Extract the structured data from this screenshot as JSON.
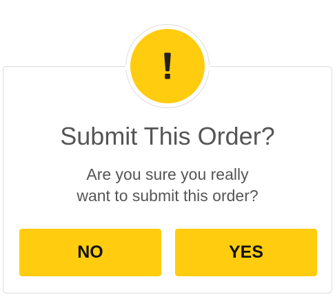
{
  "dialog": {
    "title": "Submit This Order?",
    "message": "Are you sure you really\nwant to submit this order?",
    "no_label": "NO",
    "yes_label": "YES",
    "icon": "exclamation-icon"
  },
  "colors": {
    "accent": "#ffcc0f",
    "text": "#555555",
    "button_text": "#111111",
    "border": "#dcdcdc"
  }
}
